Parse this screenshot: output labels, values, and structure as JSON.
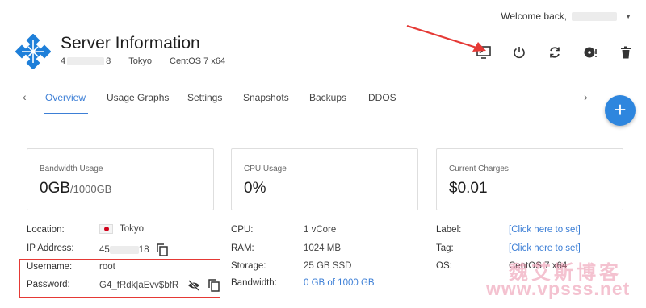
{
  "header": {
    "welcome_text": "Welcome back,",
    "title": "Server Information",
    "sub_id_left": "4",
    "sub_id_right": "8",
    "location": "Tokyo",
    "os": "CentOS 7 x64"
  },
  "actions": [
    {
      "name": "console-icon"
    },
    {
      "name": "power-icon"
    },
    {
      "name": "restart-icon"
    },
    {
      "name": "reinstall-icon"
    },
    {
      "name": "trash-icon"
    }
  ],
  "tabs": [
    {
      "label": "Overview",
      "active": true
    },
    {
      "label": "Usage Graphs"
    },
    {
      "label": "Settings"
    },
    {
      "label": "Snapshots"
    },
    {
      "label": "Backups"
    },
    {
      "label": "DDOS"
    }
  ],
  "fab": {
    "label": "+"
  },
  "cards": {
    "bandwidth": {
      "label": "Bandwidth Usage",
      "value": "0GB",
      "unit": "/1000GB"
    },
    "cpu": {
      "label": "CPU Usage",
      "value": "0%"
    },
    "charges": {
      "label": "Current Charges",
      "value": "$0.01"
    }
  },
  "details_left": {
    "location_label": "Location:",
    "location_value": "Tokyo",
    "ip_label": "IP Address:",
    "ip_left": "45",
    "ip_right": "18",
    "username_label": "Username:",
    "username_value": "root",
    "password_label": "Password:",
    "password_value": "G4_fRdk|aEvv$bfR"
  },
  "details_mid": {
    "cpu_label": "CPU:",
    "cpu_value": "1 vCore",
    "ram_label": "RAM:",
    "ram_value": "1024 MB",
    "storage_label": "Storage:",
    "storage_value": "25 GB SSD",
    "bandwidth_label": "Bandwidth:",
    "bandwidth_value": "0 GB of 1000 GB"
  },
  "details_right": {
    "label_label": "Label:",
    "label_value": "[Click here to set]",
    "tag_label": "Tag:",
    "tag_value": "[Click here to set]",
    "os_label": "OS:",
    "os_value": "CentOS 7 x64"
  },
  "watermark": {
    "cn": "魏艾斯博客",
    "en": "www.vpsss.net"
  },
  "colors": {
    "accent": "#3d7fd6",
    "fab": "#2e86de",
    "logo": "#1e7fd9",
    "arrow": "#e53935"
  }
}
